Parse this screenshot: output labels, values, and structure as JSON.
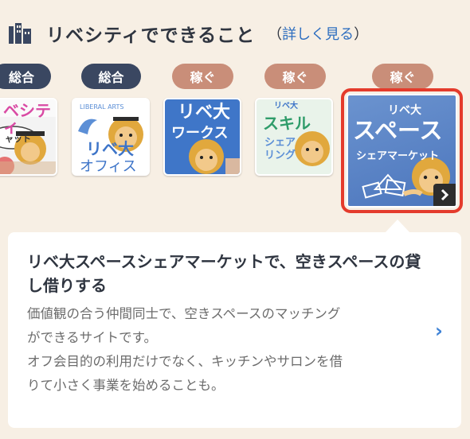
{
  "header": {
    "icon": "building-icon",
    "title": "リベシティでできること",
    "link_open": "（",
    "link_text": "詳しく見る",
    "link_close": "）"
  },
  "services": [
    {
      "badge": "総合",
      "badge_color": "#3a4761",
      "thumb_lines": [
        "ベシティ",
        "ャット"
      ],
      "icon": "liberty-chat-thumbnail"
    },
    {
      "badge": "総合",
      "badge_color": "#3a4761",
      "thumb_lines": [
        "LIBERAL ARTS",
        "リベ大",
        "オフィス"
      ],
      "icon": "liberty-office-thumbnail"
    },
    {
      "badge": "稼ぐ",
      "badge_color": "#c98e79",
      "thumb_lines": [
        "リベ大",
        "ワークス"
      ],
      "icon": "liberty-works-thumbnail"
    },
    {
      "badge": "稼ぐ",
      "badge_color": "#c98e79",
      "thumb_lines": [
        "リベ大",
        "スキル",
        "シェア",
        "リング"
      ],
      "icon": "liberty-skill-sharing-thumbnail"
    },
    {
      "badge": "稼ぐ",
      "badge_color": "#c98e79",
      "thumb_lines": [
        "リベ大",
        "スペース",
        "シェアマーケット"
      ],
      "icon": "liberty-space-market-thumbnail",
      "selected": true
    }
  ],
  "detail": {
    "title": "リベ大スペースシェアマーケットで、空きスペースの貸し借りする",
    "desc_line1": "価値観の合う仲間同士で、空きスペースのマッチング",
    "desc_line2": "ができるサイトです。",
    "desc_line3": "オフ会目的の利用だけでなく、キッチンやサロンを借",
    "desc_line4": "りて小さく事業を始めることも。",
    "chevron": "›"
  },
  "colors": {
    "background": "#f7efe4",
    "accent_blue": "#3e82d6",
    "selection_red": "#e43b2c"
  }
}
